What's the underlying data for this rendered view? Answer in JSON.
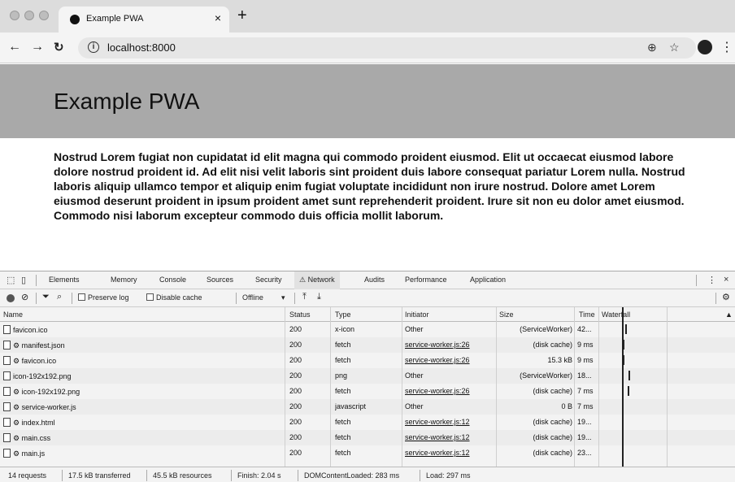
{
  "browser": {
    "tab_title": "Example PWA",
    "new_tab_label": "+",
    "close_label": "×",
    "url": "localhost:8000"
  },
  "page": {
    "title": "Example PWA",
    "body": "Nostrud Lorem fugiat non cupidatat id elit magna qui commodo proident eiusmod. Elit ut occaecat eiusmod labore dolore nostrud proident id. Ad elit nisi velit laboris sint proident duis labore consequat pariatur Lorem nulla. Nostrud laboris aliquip ullamco tempor et aliquip enim fugiat voluptate incididunt non irure nostrud. Dolore amet Lorem eiusmod deserunt proident in ipsum proident amet sunt reprehenderit proident. Irure sit non eu dolor amet eiusmod. Commodo nisi laborum excepteur commodo duis officia mollit laborum."
  },
  "devtools": {
    "tabs": [
      "Elements",
      "Memory",
      "Console",
      "Sources",
      "Security",
      "Network",
      "Audits",
      "Performance",
      "Application"
    ],
    "active_tab": "Network",
    "controls": {
      "preserve_log": "Preserve log",
      "disable_cache": "Disable cache",
      "throttle": "Offline"
    },
    "columns": {
      "name": "Name",
      "status": "Status",
      "type": "Type",
      "initiator": "Initiator",
      "size": "Size",
      "time": "Time",
      "waterfall": "Waterfall"
    },
    "rows": [
      {
        "name": "favicon.ico",
        "status": "200",
        "type": "x-icon",
        "initiator": "Other",
        "size": "(ServiceWorker)",
        "time": "42...",
        "wf": 0.02
      },
      {
        "name": "⚙ manifest.json",
        "status": "200",
        "type": "fetch",
        "initiator": "service-worker.js:26",
        "size": "(disk cache)",
        "time": "9 ms",
        "wf": 0.0
      },
      {
        "name": "⚙ favicon.ico",
        "status": "200",
        "type": "fetch",
        "initiator": "service-worker.js:26",
        "size": "15.3 kB",
        "time": "9 ms",
        "wf": 0.0
      },
      {
        "name": "icon-192x192.png",
        "status": "200",
        "type": "png",
        "initiator": "Other",
        "size": "(ServiceWorker)",
        "time": "18...",
        "wf": 0.05
      },
      {
        "name": "⚙ icon-192x192.png",
        "status": "200",
        "type": "fetch",
        "initiator": "service-worker.js:26",
        "size": "(disk cache)",
        "time": "7 ms",
        "wf": 0.04
      },
      {
        "name": "⚙ service-worker.js",
        "status": "200",
        "type": "javascript",
        "initiator": "Other",
        "size": "0 B",
        "time": "7 ms",
        "wf": null
      },
      {
        "name": "⚙ index.html",
        "status": "200",
        "type": "fetch",
        "initiator": "service-worker.js:12",
        "size": "(disk cache)",
        "time": "19...",
        "wf": null
      },
      {
        "name": "⚙ main.css",
        "status": "200",
        "type": "fetch",
        "initiator": "service-worker.js:12",
        "size": "(disk cache)",
        "time": "19...",
        "wf": null
      },
      {
        "name": "⚙ main.js",
        "status": "200",
        "type": "fetch",
        "initiator": "service-worker.js:12",
        "size": "(disk cache)",
        "time": "23...",
        "wf": null
      }
    ],
    "status_bar": [
      "14 requests",
      "17.5 kB transferred",
      "45.5 kB resources",
      "Finish: 2.04 s",
      "DOMContentLoaded: 283 ms",
      "Load: 297 ms"
    ]
  }
}
